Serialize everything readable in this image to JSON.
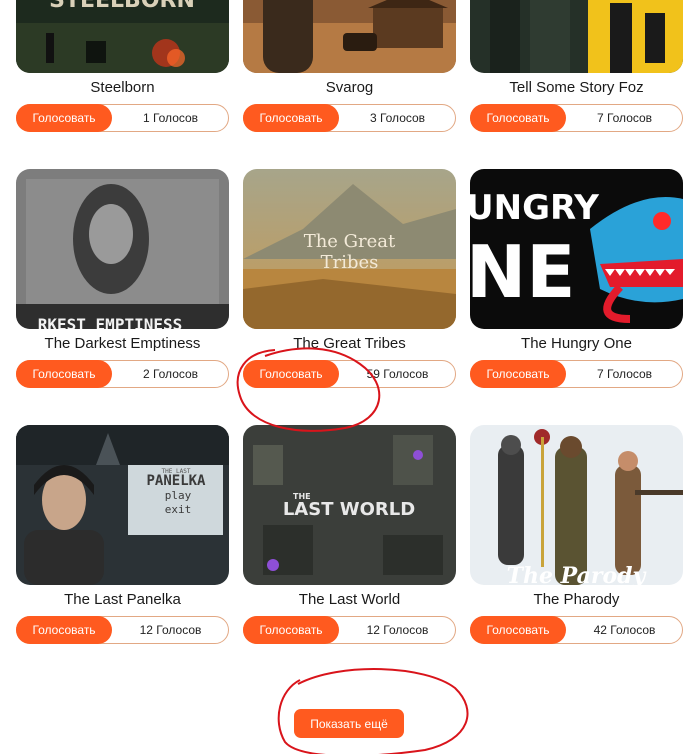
{
  "vote_button_label": "Голосовать",
  "show_more_label": "Показать ещё",
  "games": [
    {
      "title": "Steelborn",
      "votes": "1 Голосов",
      "art_text": "STEELBORN"
    },
    {
      "title": "Svarog",
      "votes": "3 Голосов"
    },
    {
      "title": "Tell Some Story Foz",
      "votes": "7 Голосов"
    },
    {
      "title": "The Darkest Emptiness",
      "votes": "2 Голосов",
      "art_text": "RKEST EMPTINESS"
    },
    {
      "title": "The Great Tribes",
      "votes": "59 Голосов",
      "art_text_1": "The Great",
      "art_text_2": "Tribes"
    },
    {
      "title": "The Hungry One",
      "votes": "7 Голосов",
      "art_text_1": "UNGRY",
      "art_text_2": "NE"
    },
    {
      "title": "The Last Panelka",
      "votes": "12 Голосов",
      "art_text_small": "THE LAST",
      "art_text_1": "PANELKA",
      "art_text_2": "play",
      "art_text_3": "exit"
    },
    {
      "title": "The Last World",
      "votes": "12 Голосов",
      "art_text_small": "THE",
      "art_text_1": "LAST WORLD"
    },
    {
      "title": "The Pharody",
      "votes": "42 Голосов",
      "art_text": "The Parody"
    }
  ],
  "colors": {
    "accent": "#ff5a1f",
    "annotation": "#d9141b",
    "border": "#e2a884"
  }
}
